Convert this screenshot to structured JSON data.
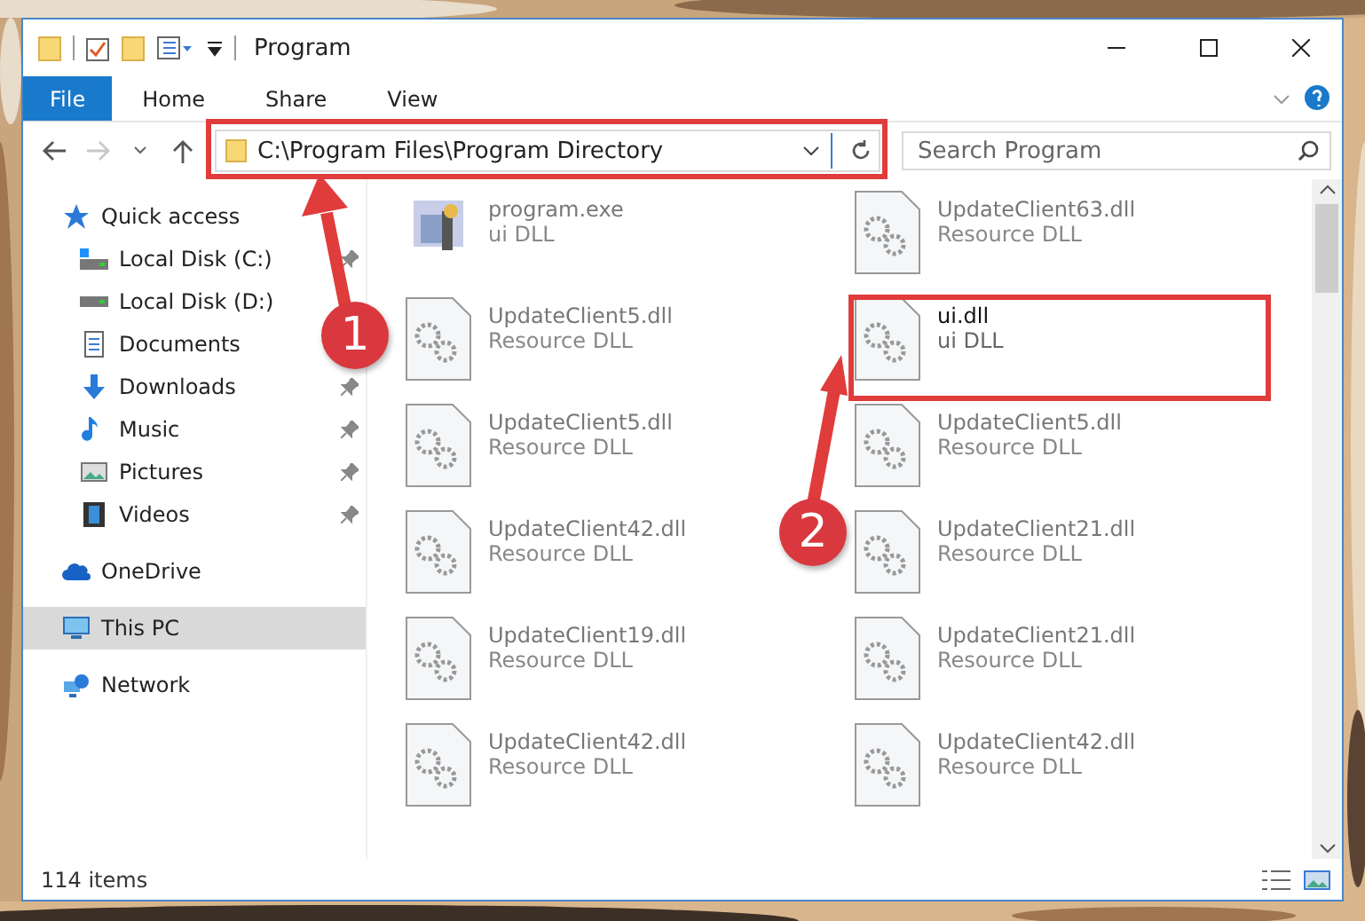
{
  "window": {
    "title": "Program"
  },
  "ribbon": {
    "tabs": [
      {
        "label": "File",
        "selected": true
      },
      {
        "label": "Home",
        "selected": false
      },
      {
        "label": "Share",
        "selected": false
      },
      {
        "label": "View",
        "selected": false
      }
    ]
  },
  "address": {
    "path": "C:\\Program Files\\Program Directory",
    "forward_disabled": true
  },
  "search": {
    "placeholder": "Search Program"
  },
  "nav": [
    {
      "label": "Quick access",
      "kind": "quick",
      "selected": false,
      "children": [
        {
          "label": "Local Disk (C:)",
          "kind": "drive-c",
          "selected": false,
          "pinned": true
        },
        {
          "label": "Local Disk (D:)",
          "kind": "drive",
          "selected": false
        },
        {
          "label": "Documents",
          "kind": "documents",
          "selected": false
        },
        {
          "label": "Downloads",
          "kind": "downloads",
          "selected": false,
          "pinned": true
        },
        {
          "label": "Music",
          "kind": "music",
          "selected": false,
          "pinned": true
        },
        {
          "label": "Pictures",
          "kind": "pictures",
          "selected": false,
          "pinned": true
        },
        {
          "label": "Videos",
          "kind": "videos",
          "selected": false,
          "pinned": true
        }
      ]
    },
    {
      "label": "OneDrive",
      "kind": "cloud",
      "selected": false
    },
    {
      "label": "This PC",
      "kind": "pc",
      "selected": true
    },
    {
      "label": "Network",
      "kind": "network",
      "selected": false
    }
  ],
  "files": [
    {
      "name": "program.exe",
      "type": "ui DLL",
      "kind": "exe",
      "blurred": true
    },
    {
      "name": "UpdateClient63.dll",
      "type": "Resource DLL",
      "kind": "dll",
      "blurred": true
    },
    {
      "name": "UpdateClient5.dll",
      "type": "Resource DLL",
      "kind": "dll",
      "blurred": true
    },
    {
      "name": "ui.dll",
      "type": "ui DLL",
      "kind": "dll",
      "blurred": false
    },
    {
      "name": "UpdateClient5.dll",
      "type": "Resource DLL",
      "kind": "dll",
      "blurred": true
    },
    {
      "name": "UpdateClient5.dll",
      "type": "Resource DLL",
      "kind": "dll",
      "blurred": true
    },
    {
      "name": "UpdateClient42.dll",
      "type": "Resource DLL",
      "kind": "dll",
      "blurred": true
    },
    {
      "name": "UpdateClient21.dll",
      "type": "Resource DLL",
      "kind": "dll",
      "blurred": true
    },
    {
      "name": "UpdateClient19.dll",
      "type": "Resource DLL",
      "kind": "dll",
      "blurred": true
    },
    {
      "name": "UpdateClient21.dll",
      "type": "Resource DLL",
      "kind": "dll",
      "blurred": true
    },
    {
      "name": "UpdateClient42.dll",
      "type": "Resource DLL",
      "kind": "dll",
      "blurred": true
    },
    {
      "name": "UpdateClient42.dll",
      "type": "Resource DLL",
      "kind": "dll",
      "blurred": true
    }
  ],
  "status_bar": {
    "count": "114 items"
  },
  "annotations": [
    {
      "label": "1"
    },
    {
      "label": "2"
    }
  ]
}
